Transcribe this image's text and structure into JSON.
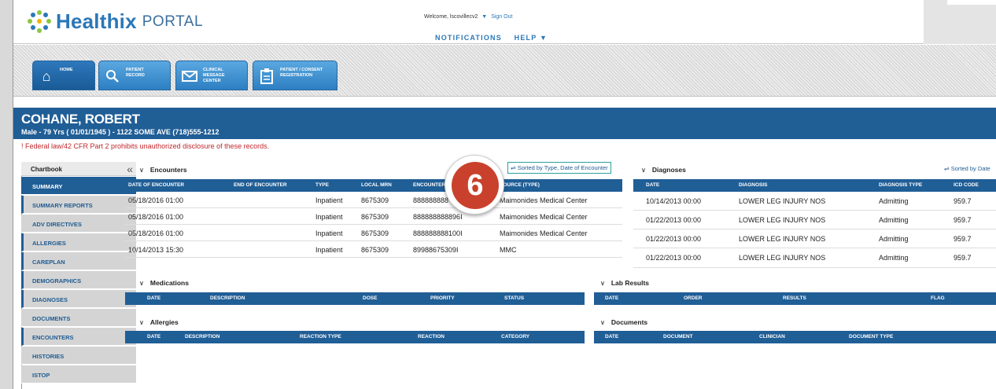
{
  "header": {
    "logo_text": "Healthix",
    "logo_sub": "PORTAL",
    "welcome": "Welcome, lscovillecv2",
    "sign_out": "Sign Out",
    "nav": [
      "NOTIFICATIONS",
      "HELP ▼"
    ]
  },
  "tabs": [
    {
      "label": "HOME",
      "icon": "home-icon"
    },
    {
      "label": "PATIENT RECORD",
      "icon": "search-icon"
    },
    {
      "label": "CLINICAL MESSAGE CENTER",
      "icon": "envelope-icon"
    },
    {
      "label": "PATIENT / CONSENT REGISTRATION",
      "icon": "clipboard-icon"
    }
  ],
  "patient": {
    "name": "COHANE, ROBERT",
    "info": "Male - 79 Yrs ( 01/01/1945 ) - 1122 SOME AVE (718)555-1212",
    "warning": "! Federal law/42 CFR Part 2 prohibits unauthorized disclosure of these records."
  },
  "sidebar": {
    "title": "Chartbook",
    "items": [
      "SUMMARY",
      "SUMMARY REPORTS",
      "ADV DIRECTIVES",
      "ALLERGIES",
      "CAREPLAN",
      "DEMOGRAPHICS",
      "DIAGNOSES",
      "DOCUMENTS",
      "ENCOUNTERS",
      "HISTORIES",
      "iSTOP"
    ]
  },
  "encounters": {
    "title": "Encounters",
    "sort_label": "Sorted by Type, Date of Encounter",
    "columns": [
      "DATE OF ENCOUNTER",
      "END OF ENCOUNTER",
      "TYPE",
      "LOCAL MRN",
      "ENCOUNTER #",
      "SOURCE (TYPE)"
    ],
    "rows": [
      [
        "05/18/2016 01:00",
        "",
        "Inpatient",
        "8675309",
        "888888888",
        "Maimonides Medical Center"
      ],
      [
        "05/18/2016 01:00",
        "",
        "Inpatient",
        "8675309",
        "888888888896I",
        "Maimonides Medical Center"
      ],
      [
        "05/18/2016 01:00",
        "",
        "Inpatient",
        "8675309",
        "888888888100I",
        "Maimonides Medical Center"
      ],
      [
        "10/14/2013 15:30",
        "",
        "Inpatient",
        "8675309",
        "89988675309I",
        "MMC"
      ]
    ]
  },
  "diagnoses": {
    "title": "Diagnoses",
    "sort_label": "Sorted by Date",
    "columns": [
      "DATE",
      "DIAGNOSIS",
      "DIAGNOSIS TYPE",
      "ICD CODE"
    ],
    "rows": [
      [
        "10/14/2013 00:00",
        "LOWER LEG INJURY NOS",
        "Admitting",
        "959.7"
      ],
      [
        "01/22/2013 00:00",
        "LOWER LEG INJURY NOS",
        "Admitting",
        "959.7"
      ],
      [
        "01/22/2013 00:00",
        "LOWER LEG INJURY NOS",
        "Admitting",
        "959.7"
      ],
      [
        "01/22/2013 00:00",
        "LOWER LEG INJURY NOS",
        "Admitting",
        "959.7"
      ]
    ]
  },
  "medications": {
    "title": "Medications",
    "columns": [
      "DATE",
      "DESCRIPTION",
      "DOSE",
      "PRIORITY",
      "STATUS"
    ]
  },
  "lab_results": {
    "title": "Lab Results",
    "columns": [
      "DATE",
      "ORDER",
      "RESULTS",
      "FLAG"
    ]
  },
  "allergies": {
    "title": "Allergies",
    "columns": [
      "DATE",
      "DESCRIPTION",
      "REACTION TYPE",
      "REACTION",
      "CATEGORY"
    ]
  },
  "documents": {
    "title": "Documents",
    "columns": [
      "DATE",
      "DOCUMENT",
      "CLINICIAN",
      "DOCUMENT TYPE"
    ]
  },
  "callout_number": "6",
  "colors": {
    "brand_blue": "#205e96",
    "warning_red": "#c0282d",
    "callout_red": "#c9412c"
  }
}
